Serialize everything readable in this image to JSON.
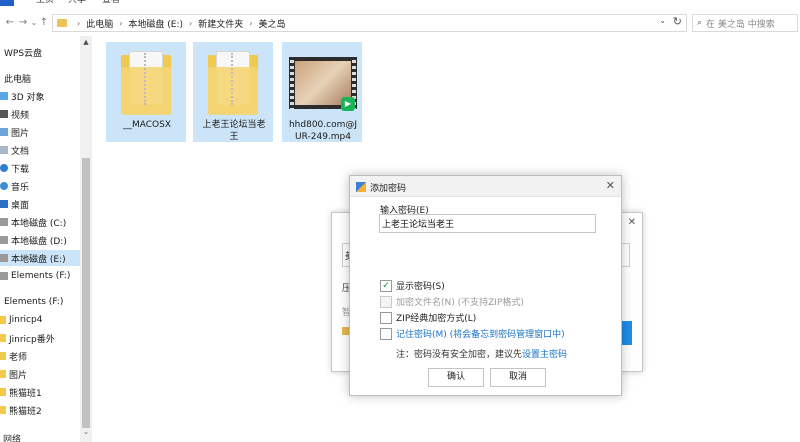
{
  "ribbon": {
    "tabs": [
      "主页",
      "共享",
      "查看"
    ]
  },
  "addressbar": {
    "crumbs": [
      "此电脑",
      "本地磁盘 (E:)",
      "新建文件夹",
      "美之岛"
    ]
  },
  "search": {
    "placeholder": "在 美之岛 中搜索"
  },
  "sidebar": {
    "items": [
      "WPS云盘",
      "此电脑",
      "3D 对象",
      "视频",
      "图片",
      "文档",
      "下载",
      "音乐",
      "桌面",
      "本地磁盘 (C:)",
      "本地磁盘 (D:)",
      "本地磁盘 (E:)",
      "Elements (F:)",
      "Elements (F:)",
      "Jinricp4",
      "Jinricp番外",
      "老师",
      "图片",
      "熊猫班1",
      "熊猫班2",
      "网络"
    ]
  },
  "files": [
    {
      "name": "__MACOSX",
      "type": "zip-folder"
    },
    {
      "name": "上老王论坛当老\n王",
      "type": "zip-folder"
    },
    {
      "name": "hhd800.com@J\nUR-249.mp4",
      "type": "video"
    }
  ],
  "bg_dialog": {
    "input_text": "美",
    "line1": "压",
    "line2": "智"
  },
  "dialog": {
    "title": "添加密码",
    "password_label": "输入密码(E)",
    "password_value": "上老王论坛当老王",
    "options": [
      {
        "label": "显示密码(S)",
        "checked": true,
        "disabled": false
      },
      {
        "label": "加密文件名(N) (不支持ZIP格式)",
        "checked": false,
        "disabled": true
      },
      {
        "label": "ZIP经典加密方式(L)",
        "checked": false,
        "disabled": false
      },
      {
        "label": "记住密码(M) (将会备忘到密码管理窗口中)",
        "checked": false,
        "disabled": false
      }
    ],
    "note_prefix": "注：密码没有安全加密，建议先",
    "note_link": "设置主密码",
    "ok_label": "确认",
    "cancel_label": "取消"
  }
}
